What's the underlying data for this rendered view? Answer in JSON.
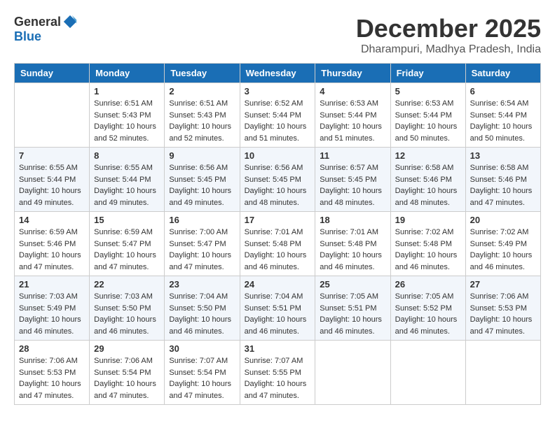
{
  "logo": {
    "general": "General",
    "blue": "Blue"
  },
  "title": "December 2025",
  "location": "Dharampuri, Madhya Pradesh, India",
  "days_of_week": [
    "Sunday",
    "Monday",
    "Tuesday",
    "Wednesday",
    "Thursday",
    "Friday",
    "Saturday"
  ],
  "weeks": [
    [
      {
        "day": "",
        "sunrise": "",
        "sunset": "",
        "daylight": ""
      },
      {
        "day": "1",
        "sunrise": "Sunrise: 6:51 AM",
        "sunset": "Sunset: 5:43 PM",
        "daylight": "Daylight: 10 hours and 52 minutes."
      },
      {
        "day": "2",
        "sunrise": "Sunrise: 6:51 AM",
        "sunset": "Sunset: 5:43 PM",
        "daylight": "Daylight: 10 hours and 52 minutes."
      },
      {
        "day": "3",
        "sunrise": "Sunrise: 6:52 AM",
        "sunset": "Sunset: 5:44 PM",
        "daylight": "Daylight: 10 hours and 51 minutes."
      },
      {
        "day": "4",
        "sunrise": "Sunrise: 6:53 AM",
        "sunset": "Sunset: 5:44 PM",
        "daylight": "Daylight: 10 hours and 51 minutes."
      },
      {
        "day": "5",
        "sunrise": "Sunrise: 6:53 AM",
        "sunset": "Sunset: 5:44 PM",
        "daylight": "Daylight: 10 hours and 50 minutes."
      },
      {
        "day": "6",
        "sunrise": "Sunrise: 6:54 AM",
        "sunset": "Sunset: 5:44 PM",
        "daylight": "Daylight: 10 hours and 50 minutes."
      }
    ],
    [
      {
        "day": "7",
        "sunrise": "Sunrise: 6:55 AM",
        "sunset": "Sunset: 5:44 PM",
        "daylight": "Daylight: 10 hours and 49 minutes."
      },
      {
        "day": "8",
        "sunrise": "Sunrise: 6:55 AM",
        "sunset": "Sunset: 5:44 PM",
        "daylight": "Daylight: 10 hours and 49 minutes."
      },
      {
        "day": "9",
        "sunrise": "Sunrise: 6:56 AM",
        "sunset": "Sunset: 5:45 PM",
        "daylight": "Daylight: 10 hours and 49 minutes."
      },
      {
        "day": "10",
        "sunrise": "Sunrise: 6:56 AM",
        "sunset": "Sunset: 5:45 PM",
        "daylight": "Daylight: 10 hours and 48 minutes."
      },
      {
        "day": "11",
        "sunrise": "Sunrise: 6:57 AM",
        "sunset": "Sunset: 5:45 PM",
        "daylight": "Daylight: 10 hours and 48 minutes."
      },
      {
        "day": "12",
        "sunrise": "Sunrise: 6:58 AM",
        "sunset": "Sunset: 5:46 PM",
        "daylight": "Daylight: 10 hours and 48 minutes."
      },
      {
        "day": "13",
        "sunrise": "Sunrise: 6:58 AM",
        "sunset": "Sunset: 5:46 PM",
        "daylight": "Daylight: 10 hours and 47 minutes."
      }
    ],
    [
      {
        "day": "14",
        "sunrise": "Sunrise: 6:59 AM",
        "sunset": "Sunset: 5:46 PM",
        "daylight": "Daylight: 10 hours and 47 minutes."
      },
      {
        "day": "15",
        "sunrise": "Sunrise: 6:59 AM",
        "sunset": "Sunset: 5:47 PM",
        "daylight": "Daylight: 10 hours and 47 minutes."
      },
      {
        "day": "16",
        "sunrise": "Sunrise: 7:00 AM",
        "sunset": "Sunset: 5:47 PM",
        "daylight": "Daylight: 10 hours and 47 minutes."
      },
      {
        "day": "17",
        "sunrise": "Sunrise: 7:01 AM",
        "sunset": "Sunset: 5:48 PM",
        "daylight": "Daylight: 10 hours and 46 minutes."
      },
      {
        "day": "18",
        "sunrise": "Sunrise: 7:01 AM",
        "sunset": "Sunset: 5:48 PM",
        "daylight": "Daylight: 10 hours and 46 minutes."
      },
      {
        "day": "19",
        "sunrise": "Sunrise: 7:02 AM",
        "sunset": "Sunset: 5:48 PM",
        "daylight": "Daylight: 10 hours and 46 minutes."
      },
      {
        "day": "20",
        "sunrise": "Sunrise: 7:02 AM",
        "sunset": "Sunset: 5:49 PM",
        "daylight": "Daylight: 10 hours and 46 minutes."
      }
    ],
    [
      {
        "day": "21",
        "sunrise": "Sunrise: 7:03 AM",
        "sunset": "Sunset: 5:49 PM",
        "daylight": "Daylight: 10 hours and 46 minutes."
      },
      {
        "day": "22",
        "sunrise": "Sunrise: 7:03 AM",
        "sunset": "Sunset: 5:50 PM",
        "daylight": "Daylight: 10 hours and 46 minutes."
      },
      {
        "day": "23",
        "sunrise": "Sunrise: 7:04 AM",
        "sunset": "Sunset: 5:50 PM",
        "daylight": "Daylight: 10 hours and 46 minutes."
      },
      {
        "day": "24",
        "sunrise": "Sunrise: 7:04 AM",
        "sunset": "Sunset: 5:51 PM",
        "daylight": "Daylight: 10 hours and 46 minutes."
      },
      {
        "day": "25",
        "sunrise": "Sunrise: 7:05 AM",
        "sunset": "Sunset: 5:51 PM",
        "daylight": "Daylight: 10 hours and 46 minutes."
      },
      {
        "day": "26",
        "sunrise": "Sunrise: 7:05 AM",
        "sunset": "Sunset: 5:52 PM",
        "daylight": "Daylight: 10 hours and 46 minutes."
      },
      {
        "day": "27",
        "sunrise": "Sunrise: 7:06 AM",
        "sunset": "Sunset: 5:53 PM",
        "daylight": "Daylight: 10 hours and 47 minutes."
      }
    ],
    [
      {
        "day": "28",
        "sunrise": "Sunrise: 7:06 AM",
        "sunset": "Sunset: 5:53 PM",
        "daylight": "Daylight: 10 hours and 47 minutes."
      },
      {
        "day": "29",
        "sunrise": "Sunrise: 7:06 AM",
        "sunset": "Sunset: 5:54 PM",
        "daylight": "Daylight: 10 hours and 47 minutes."
      },
      {
        "day": "30",
        "sunrise": "Sunrise: 7:07 AM",
        "sunset": "Sunset: 5:54 PM",
        "daylight": "Daylight: 10 hours and 47 minutes."
      },
      {
        "day": "31",
        "sunrise": "Sunrise: 7:07 AM",
        "sunset": "Sunset: 5:55 PM",
        "daylight": "Daylight: 10 hours and 47 minutes."
      },
      {
        "day": "",
        "sunrise": "",
        "sunset": "",
        "daylight": ""
      },
      {
        "day": "",
        "sunrise": "",
        "sunset": "",
        "daylight": ""
      },
      {
        "day": "",
        "sunrise": "",
        "sunset": "",
        "daylight": ""
      }
    ]
  ]
}
